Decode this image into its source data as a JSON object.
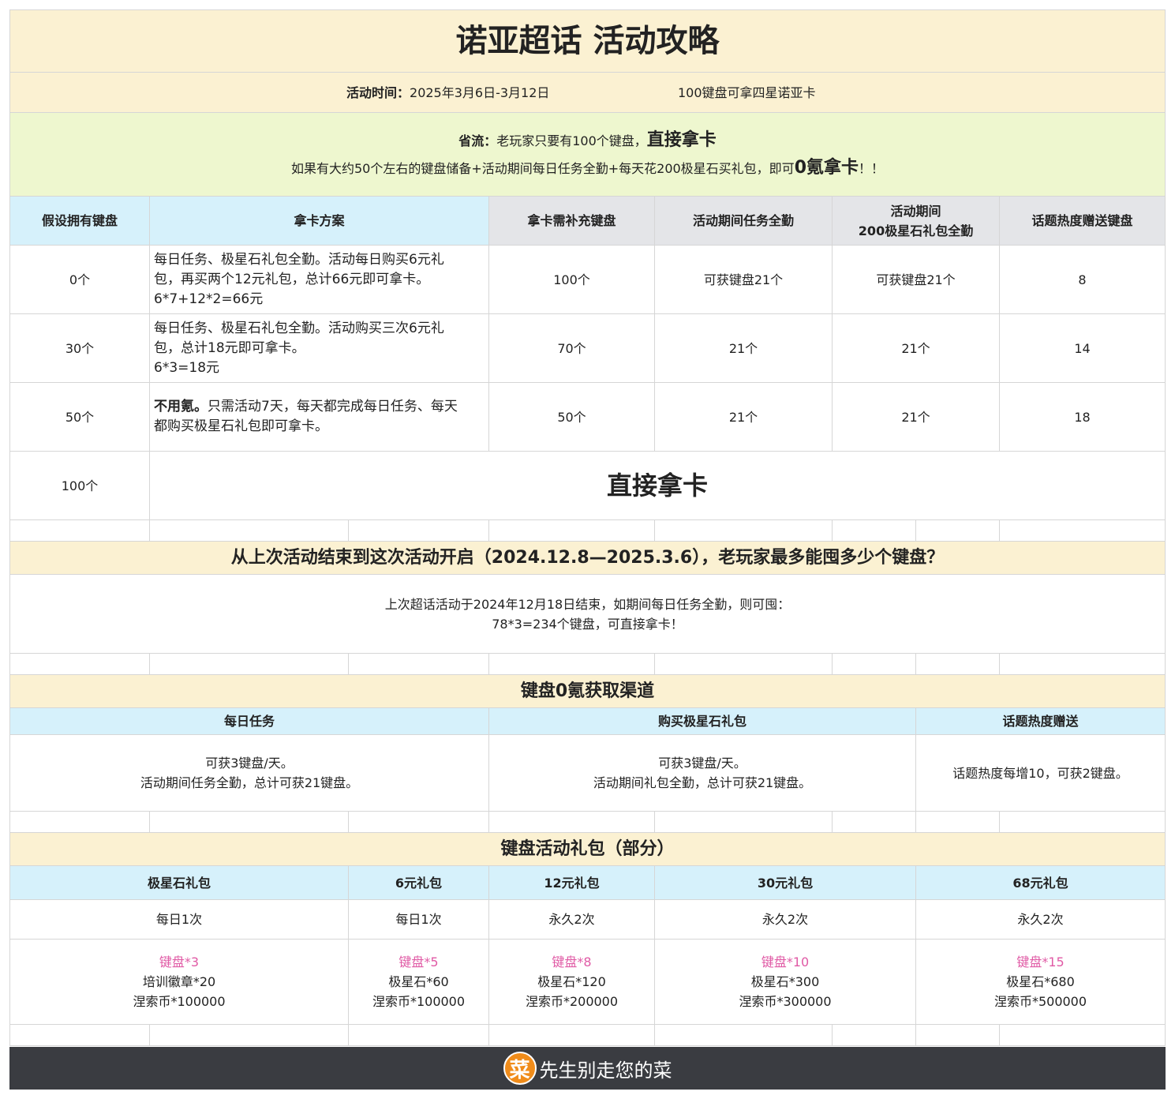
{
  "header": {
    "title": "诺亚超话 活动攻略",
    "time_label": "活动时间：",
    "time_value": "2025年3月6日-3月12日",
    "time_note": "100键盘可拿四星诺亚卡"
  },
  "tip": {
    "label": "省流：",
    "text1": "老玩家只要有100个键盘，",
    "text1_bold": "直接拿卡",
    "text2": "如果有大约50个左右的键盘储备+活动期间每日任务全勤+每天花200极星石买礼包，即可",
    "text2_bold": "0氪拿卡",
    "text2_end": "！！"
  },
  "plan_table": {
    "headers": [
      "假设拥有键盘",
      "拿卡方案",
      "拿卡需补充键盘",
      "活动期间任务全勤",
      "活动期间",
      "200极星石礼包全勤",
      "话题热度赠送键盘"
    ],
    "rows": [
      {
        "owned": "0个",
        "plan": [
          "每日任务、极星石礼包全勤。活动每日购买6元礼",
          "包，再买两个12元礼包，总计66元即可拿卡。",
          "6*7+12*2=66元"
        ],
        "need": "100个",
        "task": "可获键盘21个",
        "pack": "可获键盘21个",
        "heat": "8"
      },
      {
        "owned": "30个",
        "plan": [
          "每日任务、极星石礼包全勤。活动购买三次6元礼",
          "包，总计18元即可拿卡。",
          "6*3=18元"
        ],
        "need": "70个",
        "task": "21个",
        "pack": "21个",
        "heat": "14"
      },
      {
        "owned": "50个",
        "plan_bold": "不用氪。",
        "plan": [
          "只需活动7天，每天都完成每日任务、每天",
          "都购买极星石礼包即可拿卡。"
        ],
        "need": "50个",
        "task": "21个",
        "pack": "21个",
        "heat": "18"
      },
      {
        "owned": "100个",
        "direct": "直接拿卡"
      }
    ]
  },
  "section2": {
    "title": "从上次活动结束到这次活动开启（2024.12.8—2025.3.6），老玩家最多能囤多少个键盘？",
    "line1": "上次超话活动于2024年12月18日结束，如期间每日任务全勤，则可囤：",
    "line2": "78*3=234个键盘，可直接拿卡！"
  },
  "section3": {
    "title": "键盘0氪获取渠道",
    "headers": [
      "每日任务",
      "购买极星石礼包",
      "话题热度赠送"
    ],
    "cells": [
      [
        "可获3键盘/天。",
        "活动期间任务全勤，总计可获21键盘。"
      ],
      [
        "可获3键盘/天。",
        "活动期间礼包全勤，总计可获21键盘。"
      ],
      [
        "话题热度每增10，可获2键盘。"
      ]
    ]
  },
  "section4": {
    "title": "键盘活动礼包（部分）",
    "headers": [
      "极星石礼包",
      "6元礼包",
      "12元礼包",
      "30元礼包",
      "68元礼包"
    ],
    "limits": [
      "每日1次",
      "每日1次",
      "永久2次",
      "永久2次",
      "永久2次"
    ],
    "rewards": [
      {
        "keys": "键盘*3",
        "item": "培训徽章*20",
        "coin": "涅索币*100000"
      },
      {
        "keys": "键盘*5",
        "item": "极星石*60",
        "coin": "涅索币*100000"
      },
      {
        "keys": "键盘*8",
        "item": "极星石*120",
        "coin": "涅索币*200000"
      },
      {
        "keys": "键盘*10",
        "item": "极星石*300",
        "coin": "涅索币*300000"
      },
      {
        "keys": "键盘*15",
        "item": "极星石*680",
        "coin": "涅索币*500000"
      }
    ]
  },
  "footer": {
    "logo_char": "菜",
    "text": "先生别走您的菜"
  },
  "colors": {
    "cream": "#fbf1d2",
    "green": "#eef7cf",
    "blue": "#d6f1fb",
    "grey": "#e4e5e8",
    "pink": "#e05aa5",
    "footer_bg": "#3a3c41",
    "logo": "#f08c1a"
  }
}
